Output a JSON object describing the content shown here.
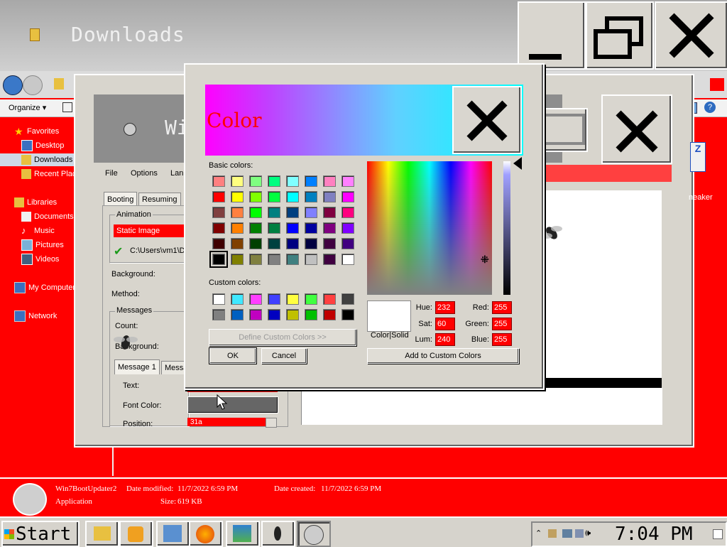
{
  "explorer": {
    "title": "Downloads",
    "menu": {
      "organize": "Organize"
    },
    "sidebar": [
      {
        "label": "Favorites",
        "icon": "star-icon"
      },
      {
        "label": "Desktop",
        "icon": "desktop-icon"
      },
      {
        "label": "Downloads",
        "icon": "downloads-icon"
      },
      {
        "label": "Recent Places",
        "icon": "recent-places-icon"
      },
      {
        "label": "Libraries",
        "icon": "library-icon"
      },
      {
        "label": "Documents",
        "icon": "documents-icon"
      },
      {
        "label": "Music",
        "icon": "music-icon"
      },
      {
        "label": "Pictures",
        "icon": "pictures-icon"
      },
      {
        "label": "Videos",
        "icon": "videos-icon"
      },
      {
        "label": "My Computer",
        "icon": "computer-icon"
      },
      {
        "label": "Network",
        "icon": "network-icon"
      }
    ],
    "details": {
      "name": "Win7BootUpdater2",
      "type": "Application",
      "modified_label": "Date modified:",
      "modified": "11/7/2022 6:59 PM",
      "size_label": "Size:",
      "size": "619 KB",
      "created_label": "Date created:",
      "created": "11/7/2022 6:59 PM"
    },
    "right_label": "neaker"
  },
  "app": {
    "title": "Wi",
    "menu": [
      "File",
      "Options",
      "Lan"
    ],
    "tabs": [
      "Booting",
      "Resuming"
    ],
    "animation_group": "Animation",
    "animation_value": "Static Image",
    "path": "C:\\Users\\vm1\\D",
    "background_label": "Background:",
    "method_label": "Method:",
    "messages_group": "Messages",
    "count_label": "Count:",
    "msg_background_label": "Background:",
    "msg_tabs": [
      "Message 1",
      "Messa"
    ],
    "text_label": "Text:",
    "font_color_label": "Font Color:",
    "position_label": "Position:",
    "position_value": "31a"
  },
  "color_dialog": {
    "title": "Color",
    "basic_label": "Basic colors:",
    "custom_label": "Custom colors:",
    "define_button": "Define Custom Colors >>",
    "ok_button": "OK",
    "cancel_button": "Cancel",
    "add_button": "Add to Custom Colors",
    "color_solid_label": "Color|Solid",
    "hue_label": "Hue:",
    "hue": "232",
    "sat_label": "Sat:",
    "sat": "60",
    "lum_label": "Lum:",
    "lum": "240",
    "red_label": "Red:",
    "red": "255",
    "green_label": "Green:",
    "green": "255",
    "blue_label": "Blue:",
    "blue": "255",
    "basic_colors": [
      "#ff8080",
      "#ffff80",
      "#80ff80",
      "#00ff80",
      "#80ffff",
      "#0080ff",
      "#ff80c0",
      "#ff80ff",
      "#ff0000",
      "#ffff00",
      "#80ff00",
      "#00ff40",
      "#00ffff",
      "#0080c0",
      "#8080c0",
      "#ff00ff",
      "#804040",
      "#ff8040",
      "#00ff00",
      "#008080",
      "#004080",
      "#8080ff",
      "#800040",
      "#ff0080",
      "#800000",
      "#ff8000",
      "#008000",
      "#008040",
      "#0000ff",
      "#0000a0",
      "#800080",
      "#8000ff",
      "#400000",
      "#804000",
      "#004000",
      "#004040",
      "#000080",
      "#000040",
      "#400040",
      "#400080",
      "#000000",
      "#808000",
      "#808040",
      "#808080",
      "#408080",
      "#c0c0c0",
      "#400040",
      "#ffffff"
    ],
    "selected_basic": 40,
    "custom_colors": [
      "#ffffff",
      "#40e8ff",
      "#ff40ff",
      "#4040ff",
      "#ffff40",
      "#40ff40",
      "#ff4040",
      "#404040",
      "#808080",
      "#0060c0",
      "#c000c0",
      "#0000c0",
      "#c0c000",
      "#00c000",
      "#c00000",
      "#000000"
    ]
  },
  "taskbar": {
    "start": "Start",
    "apps": [
      "file-explorer-icon",
      "media-player-icon",
      "control-panel-icon",
      "firefox-icon",
      "display-settings-icon",
      "fly-icon",
      "boot-updater-icon"
    ],
    "clock": "7:04 PM"
  },
  "colors": {
    "accent_red": "#ff0000",
    "dialog_bg": "#d8d5cd"
  }
}
